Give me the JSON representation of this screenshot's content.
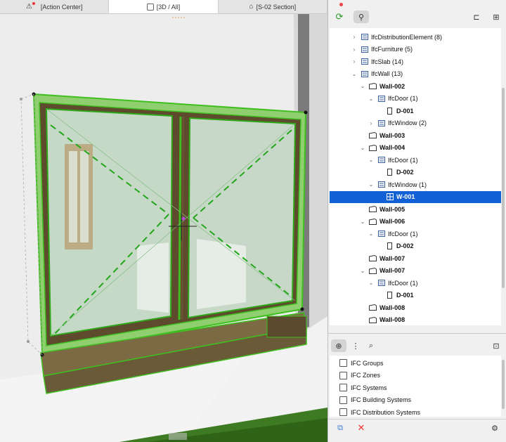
{
  "tabs": [
    {
      "label": "[Action Center]",
      "icon": "warning-icon"
    },
    {
      "label": "[3D / All]",
      "icon": "cube-icon"
    },
    {
      "label": "[S-02 Section]",
      "icon": "section-icon"
    }
  ],
  "tree": {
    "rows": [
      {
        "label": "IfcDistributionElement (8)",
        "indent": 0,
        "arrow": "›",
        "icon": "ifc-class-icon",
        "bold": false,
        "selected": false
      },
      {
        "label": "IfcFurniture (5)",
        "indent": 0,
        "arrow": "›",
        "icon": "ifc-class-icon",
        "bold": false,
        "selected": false
      },
      {
        "label": "IfcSlab (14)",
        "indent": 0,
        "arrow": "›",
        "icon": "ifc-class-icon",
        "bold": false,
        "selected": false
      },
      {
        "label": "IfcWall (13)",
        "indent": 0,
        "arrow": "⌄",
        "icon": "ifc-class-icon",
        "bold": false,
        "selected": false
      },
      {
        "label": "Wall-002",
        "indent": 1,
        "arrow": "⌄",
        "icon": "wall-icon",
        "bold": true,
        "selected": false
      },
      {
        "label": "IfcDoor (1)",
        "indent": 2,
        "arrow": "⌄",
        "icon": "ifc-class-icon",
        "bold": false,
        "selected": false
      },
      {
        "label": "D-001",
        "indent": 3,
        "arrow": "",
        "icon": "door-icon",
        "bold": true,
        "selected": false
      },
      {
        "label": "IfcWindow (2)",
        "indent": 2,
        "arrow": "›",
        "icon": "ifc-class-icon",
        "bold": false,
        "selected": false
      },
      {
        "label": "Wall-003",
        "indent": 1,
        "arrow": "",
        "icon": "wall-icon",
        "bold": true,
        "selected": false
      },
      {
        "label": "Wall-004",
        "indent": 1,
        "arrow": "⌄",
        "icon": "wall-icon",
        "bold": true,
        "selected": false
      },
      {
        "label": "IfcDoor (1)",
        "indent": 2,
        "arrow": "⌄",
        "icon": "ifc-class-icon",
        "bold": false,
        "selected": false
      },
      {
        "label": "D-002",
        "indent": 3,
        "arrow": "",
        "icon": "door-icon",
        "bold": true,
        "selected": false
      },
      {
        "label": "IfcWindow (1)",
        "indent": 2,
        "arrow": "⌄",
        "icon": "ifc-class-icon",
        "bold": false,
        "selected": false
      },
      {
        "label": "W-001",
        "indent": 3,
        "arrow": "",
        "icon": "window-icon",
        "bold": true,
        "selected": true
      },
      {
        "label": "Wall-005",
        "indent": 1,
        "arrow": "",
        "icon": "wall-icon",
        "bold": true,
        "selected": false
      },
      {
        "label": "Wall-006",
        "indent": 1,
        "arrow": "⌄",
        "icon": "wall-icon",
        "bold": true,
        "selected": false
      },
      {
        "label": "IfcDoor (1)",
        "indent": 2,
        "arrow": "⌄",
        "icon": "ifc-class-icon",
        "bold": false,
        "selected": false
      },
      {
        "label": "D-002",
        "indent": 3,
        "arrow": "",
        "icon": "door-icon",
        "bold": true,
        "selected": false
      },
      {
        "label": "Wall-007",
        "indent": 1,
        "arrow": "",
        "icon": "wall-icon",
        "bold": true,
        "selected": false
      },
      {
        "label": "Wall-007",
        "indent": 1,
        "arrow": "⌄",
        "icon": "wall-icon",
        "bold": true,
        "selected": false
      },
      {
        "label": "IfcDoor (1)",
        "indent": 2,
        "arrow": "⌄",
        "icon": "ifc-class-icon",
        "bold": false,
        "selected": false
      },
      {
        "label": "D-001",
        "indent": 3,
        "arrow": "",
        "icon": "door-icon",
        "bold": true,
        "selected": false
      },
      {
        "label": "Wall-008",
        "indent": 1,
        "arrow": "",
        "icon": "wall-icon",
        "bold": true,
        "selected": false
      },
      {
        "label": "Wall-008",
        "indent": 1,
        "arrow": "",
        "icon": "wall-icon",
        "bold": true,
        "selected": false
      }
    ]
  },
  "groups": {
    "items": [
      {
        "label": "IFC Groups",
        "icon": "ifc-groups-icon"
      },
      {
        "label": "IFC Zones",
        "icon": "ifc-zones-icon"
      },
      {
        "label": "IFC Systems",
        "icon": "ifc-systems-icon"
      },
      {
        "label": "IFC Building Systems",
        "icon": "ifc-building-systems-icon"
      },
      {
        "label": "IFC Distribution Systems",
        "icon": "ifc-distribution-systems-icon"
      }
    ]
  },
  "colors": {
    "selection": "#1160d6",
    "highlight_green": "#3fbf1f",
    "wall": "#e9e9e9",
    "grass": "#3d7a22"
  }
}
